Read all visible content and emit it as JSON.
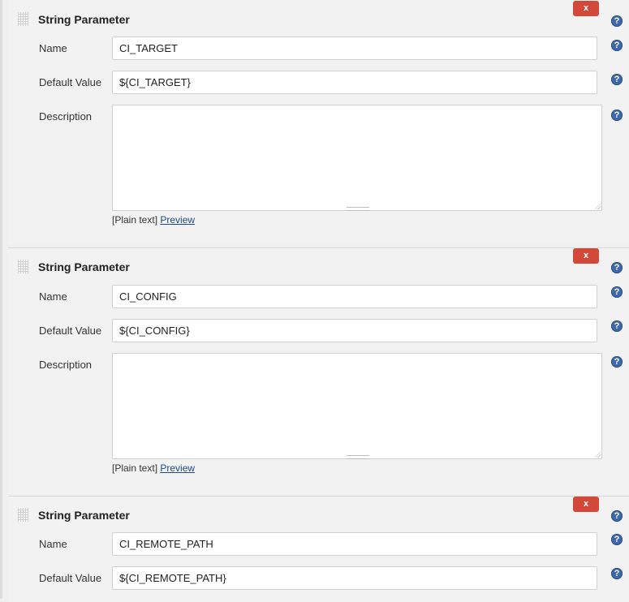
{
  "parameters": [
    {
      "title": "String Parameter",
      "delete_label": "x",
      "name_label": "Name",
      "name_value": "CI_TARGET",
      "default_label": "Default Value",
      "default_value": "${CI_TARGET}",
      "description_label": "Description",
      "description_value": "",
      "format_plain": "[Plain text]",
      "format_preview": "Preview"
    },
    {
      "title": "String Parameter",
      "delete_label": "x",
      "name_label": "Name",
      "name_value": "CI_CONFIG",
      "default_label": "Default Value",
      "default_value": "${CI_CONFIG}",
      "description_label": "Description",
      "description_value": "",
      "format_plain": "[Plain text]",
      "format_preview": "Preview"
    },
    {
      "title": "String Parameter",
      "delete_label": "x",
      "name_label": "Name",
      "name_value": "CI_REMOTE_PATH",
      "default_label": "Default Value",
      "default_value": "${CI_REMOTE_PATH}"
    }
  ],
  "help_glyph": "?",
  "icons": {
    "help": "help-icon",
    "drag": "drag-handle-icon",
    "delete": "delete-icon"
  },
  "colors": {
    "delete_button": "#d24939",
    "help_icon": "#3e68a8",
    "link": "#204a87"
  }
}
